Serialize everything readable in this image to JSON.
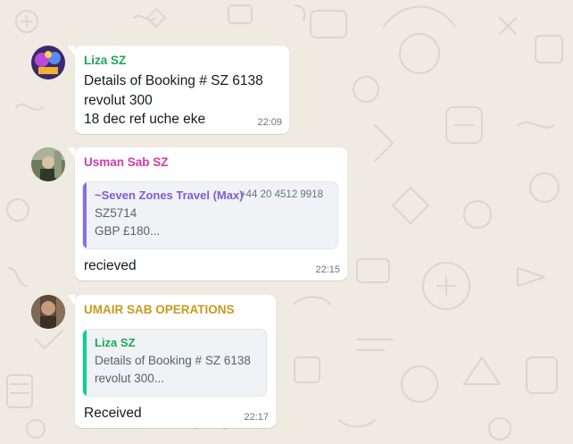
{
  "chat": {
    "background": "#efeae2",
    "messages": [
      {
        "sender": "Liza SZ",
        "sender_color": "#1fa855",
        "avatar": "contact-avatar",
        "lines": [
          "Details of Booking # SZ 6138",
          "revolut 300",
          "18 dec ref uche eke"
        ],
        "time": "22:09"
      },
      {
        "sender": "Usman Sab SZ",
        "sender_color": "#d13ba8",
        "avatar": "contact-avatar",
        "quote": {
          "sender": "~Seven Zones Travel (Max)",
          "sender_color": "#7c5fd6",
          "bar_color": "#8b6fdc",
          "phone": "+44 20 4512 9918",
          "lines": [
            "SZ5714",
            "GBP £180..."
          ]
        },
        "text": "recieved",
        "time": "22:15"
      },
      {
        "sender": "UMAIR SAB OPERATIONS",
        "sender_color": "#c79a1d",
        "avatar": "contact-avatar",
        "quote": {
          "sender": "Liza SZ",
          "sender_color": "#1fa855",
          "bar_color": "#06cf9c",
          "lines": [
            "Details of Booking # SZ 6138",
            "revolut 300..."
          ]
        },
        "text": "Received",
        "time": "22:17"
      }
    ]
  }
}
